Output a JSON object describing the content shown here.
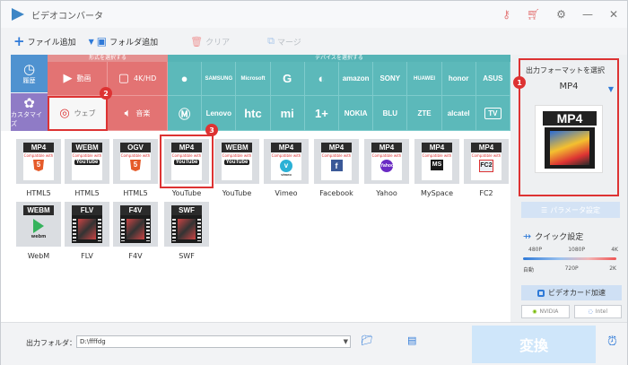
{
  "app": {
    "title": "ビデオコンバータ"
  },
  "toolbar": {
    "add_file": "ファイル追加",
    "add_folder": "フォルダ追加",
    "clear": "クリア",
    "merge": "マージ"
  },
  "nav": {
    "history": "履歴",
    "custom": "カスタマイズ"
  },
  "format_section": {
    "header": "形式を選択する",
    "items": [
      "動画",
      "4K/HD",
      "ウェブ",
      "音楽"
    ]
  },
  "device_section": {
    "header": "デバイスを選択する",
    "row1": [
      "",
      "SAMSUNG",
      "Microsoft",
      "G",
      "LG",
      "amazon",
      "SONY",
      "HUAWEI",
      "honor",
      "ASUS"
    ],
    "row2": [
      "M",
      "Lenovo",
      "htc",
      "mi",
      "1+",
      "NOKIA",
      "BLU",
      "ZTE",
      "alcatel",
      "TV"
    ]
  },
  "formats": [
    {
      "tag": "MP4",
      "badge": "5",
      "label": "HTML5"
    },
    {
      "tag": "WEBM",
      "badge": "YouTube",
      "label": "HTML5"
    },
    {
      "tag": "OGV",
      "badge": "5",
      "label": "HTML5"
    },
    {
      "tag": "MP4",
      "badge": "YouTube",
      "label": "YouTube"
    },
    {
      "tag": "WEBM",
      "badge": "YouTube",
      "label": "YouTube"
    },
    {
      "tag": "MP4",
      "badge": "vimeo",
      "label": "Vimeo"
    },
    {
      "tag": "MP4",
      "badge": "f",
      "label": "Facebook"
    },
    {
      "tag": "MP4",
      "badge": "Yahoo",
      "label": "Yahoo"
    },
    {
      "tag": "MP4",
      "badge": "MS",
      "label": "MySpace"
    },
    {
      "tag": "MP4",
      "badge": "FC2",
      "label": "FC2"
    },
    {
      "tag": "WEBM",
      "badge": "webm",
      "label": "WebM"
    },
    {
      "tag": "FLV",
      "badge": "",
      "label": "FLV"
    },
    {
      "tag": "F4V",
      "badge": "",
      "label": "F4V"
    },
    {
      "tag": "SWF",
      "badge": "",
      "label": "SWF"
    }
  ],
  "compat_text": "Compatible with",
  "output": {
    "title": "出力フォーマットを選択",
    "selected": "MP4",
    "preview_tag": "MP4"
  },
  "param_settings": "パラメータ設定",
  "quick_settings": {
    "title": "クイック設定",
    "top_labels": [
      "480P",
      "1080P",
      "4K"
    ],
    "bottom_labels": [
      "自動",
      "720P",
      "2K"
    ]
  },
  "gpu": {
    "label": "ビデオカード加速",
    "vendors": [
      "NVIDIA",
      "Intel"
    ]
  },
  "bottom": {
    "folder_label": "出力フォルダ：",
    "folder_path": "D:\\ffffdg",
    "convert": "変換"
  },
  "steps": [
    "1",
    "2",
    "3"
  ],
  "colors": {
    "accent": "#2f7ad8",
    "format_red": "#e37373",
    "device_teal": "#5cb9ba",
    "highlight": "#dd3333"
  }
}
